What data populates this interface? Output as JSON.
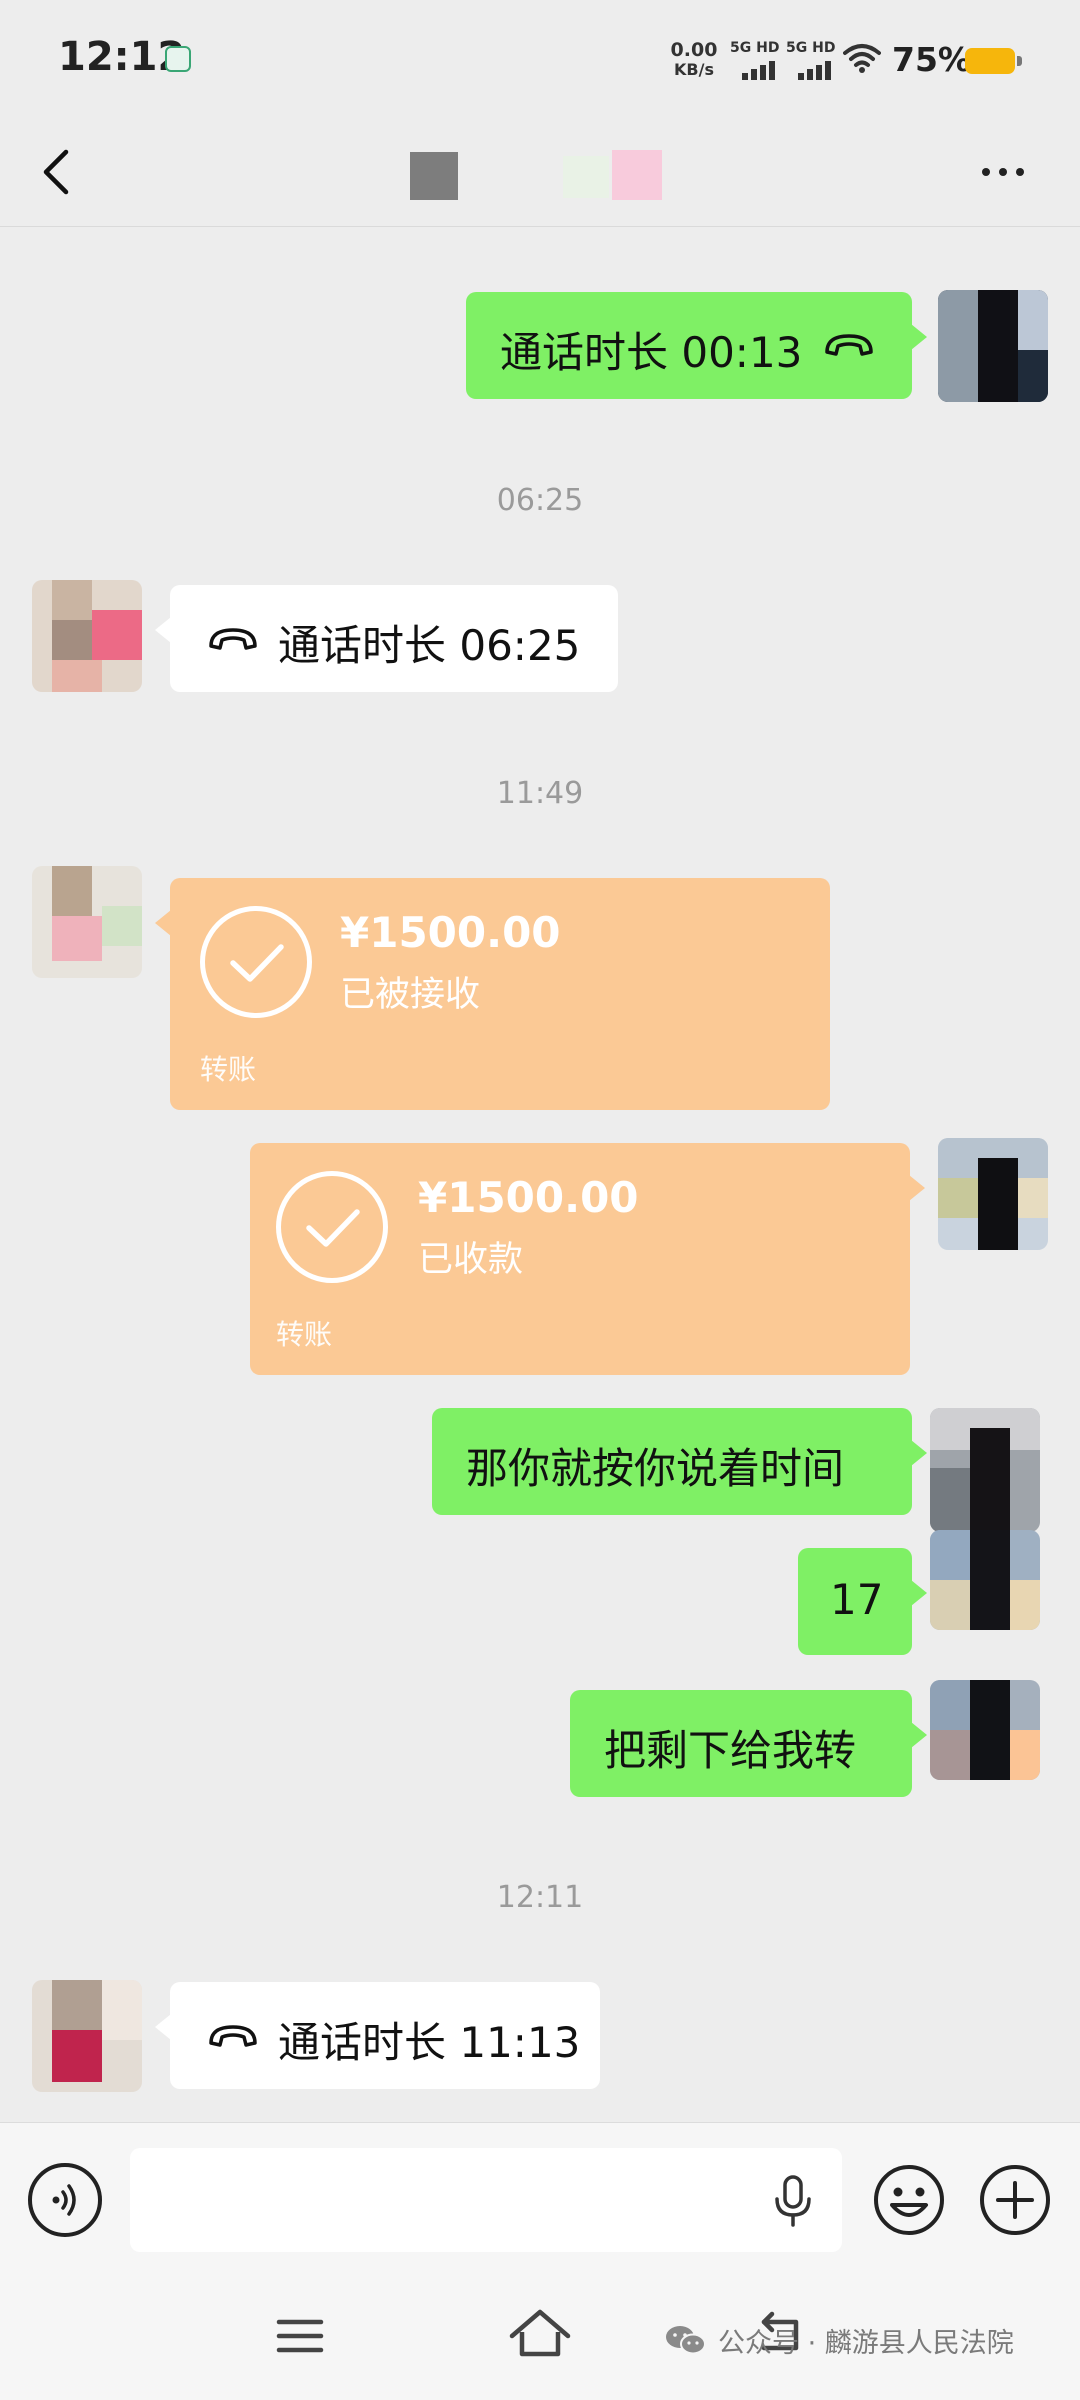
{
  "status_bar": {
    "time": "12:12",
    "net_speed_value": "0.00",
    "net_speed_unit": "KB/s",
    "signal_1": "5G HD",
    "signal_2": "5G HD",
    "battery": "75%"
  },
  "header": {
    "back_icon": "chevron-left-icon",
    "more_icon": "more-dots-icon"
  },
  "messages": {
    "m1_call_text": "通话时长 00:13",
    "ts1": "06:25",
    "m2_call_text": "通话时长 06:25",
    "ts2": "11:49",
    "m3_amount": "¥1500.00",
    "m3_status": "已被接收",
    "m3_label": "转账",
    "m4_amount": "¥1500.00",
    "m4_status": "已收款",
    "m4_label": "转账",
    "m5_text": "那你就按你说着时间",
    "m6_text": "17",
    "m7_text": "把剩下给我转",
    "ts3": "12:11",
    "m8_call_text": "通话时长 11:13"
  },
  "input_bar": {
    "placeholder": "",
    "icons": [
      "voice-icon",
      "mic-icon",
      "emoji-icon",
      "plus-icon"
    ]
  },
  "nav_bar": {
    "icons": [
      "menu-icon",
      "home-icon",
      "back-icon"
    ]
  },
  "watermark": {
    "text": "公众号 · 麟游县人民法院"
  },
  "colors": {
    "sent_bubble": "#7ff065",
    "received_bubble": "#ffffff",
    "transfer_bubble": "#fbc995",
    "background": "#ededed"
  }
}
